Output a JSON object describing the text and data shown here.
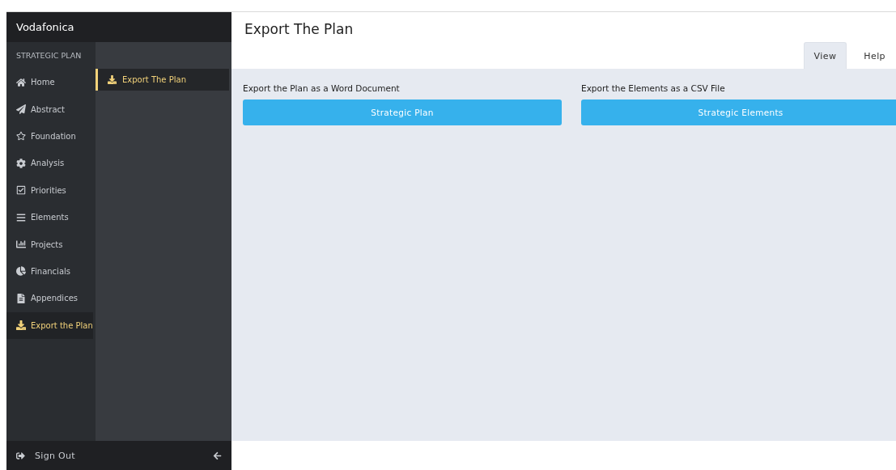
{
  "brand": "Vodafonica",
  "section_label": "STRATEGIC PLAN",
  "nav_items": [
    {
      "label": "Home",
      "selected": false
    },
    {
      "label": "Abstract",
      "selected": false
    },
    {
      "label": "Foundation",
      "selected": false
    },
    {
      "label": "Analysis",
      "selected": false
    },
    {
      "label": "Priorities",
      "selected": false
    },
    {
      "label": "Elements",
      "selected": false
    },
    {
      "label": "Projects",
      "selected": false
    },
    {
      "label": "Financials",
      "selected": false
    },
    {
      "label": "Appendices",
      "selected": false
    },
    {
      "label": "Export the Plan",
      "selected": true
    }
  ],
  "sub_nav": [
    {
      "label": "Export The Plan",
      "selected": true
    }
  ],
  "footer": {
    "sign_out": "Sign Out"
  },
  "page_title": "Export The Plan",
  "tabs": [
    {
      "label": "View",
      "selected": true
    },
    {
      "label": "Help",
      "selected": false
    }
  ],
  "exports": [
    {
      "label": "Export the Plan as a Word Document",
      "button": "Strategic Plan"
    },
    {
      "label": "Export the Elements as a CSV File",
      "button": "Strategic Elements"
    }
  ]
}
